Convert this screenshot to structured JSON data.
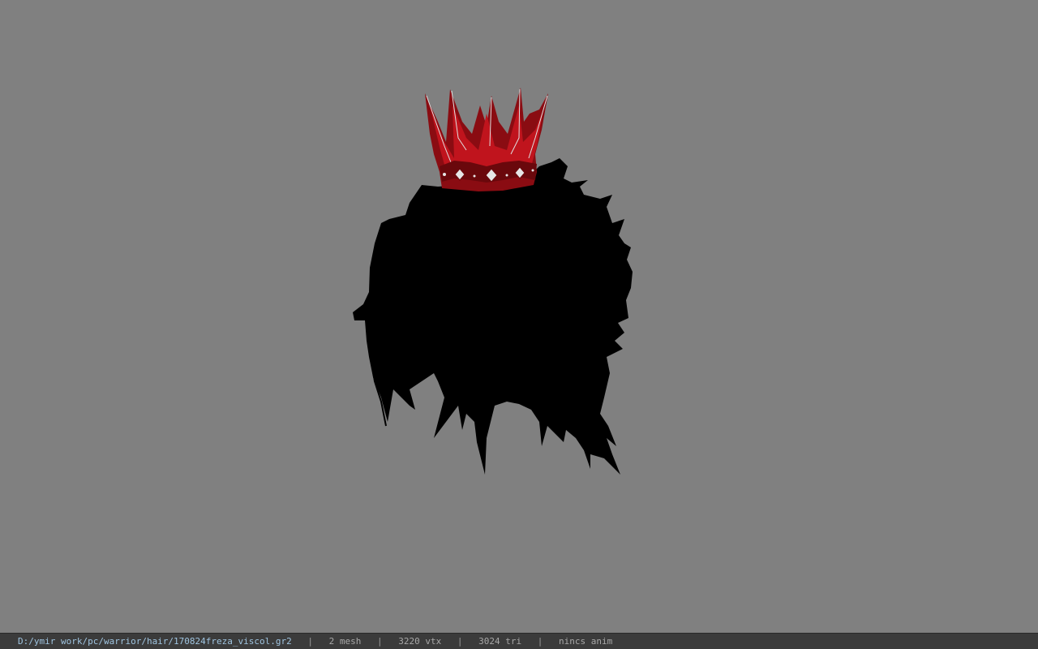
{
  "viewport": {
    "background_color": "#808080",
    "model": {
      "hair_color": "#000000",
      "crown_color": "#b3121a",
      "crown_highlight_color": "#e0e0e0"
    }
  },
  "status_bar": {
    "file_path": "D:/ymir work/pc/warrior/hair/170824freza_viscol.gr2",
    "separator": "|",
    "mesh_count": "2 mesh",
    "vertex_count": "3220 vtx",
    "triangle_count": "3024 tri",
    "anim_status": "nincs anim"
  }
}
